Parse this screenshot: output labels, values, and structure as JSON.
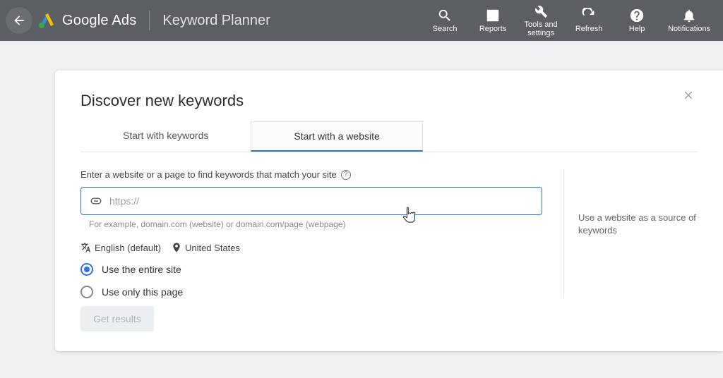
{
  "header": {
    "brand": "Google Ads",
    "subproduct": "Keyword Planner",
    "icons": {
      "search": "Search",
      "reports": "Reports",
      "tools": "Tools and\nsettings",
      "refresh": "Refresh",
      "help": "Help",
      "notifications": "Notifications"
    }
  },
  "card": {
    "title": "Discover new keywords",
    "tabs": {
      "keywords": "Start with keywords",
      "website": "Start with a website"
    },
    "form": {
      "field_label": "Enter a website or a page to find keywords that match your site",
      "url_placeholder": "https://",
      "example_hint": "For example, domain.com (website) or domain.com/page (webpage)",
      "language": "English (default)",
      "location": "United States",
      "radio_entire": "Use the entire site",
      "radio_page": "Use only this page"
    },
    "side_help": "Use a website as a source of keywords",
    "submit_label": "Get results"
  }
}
